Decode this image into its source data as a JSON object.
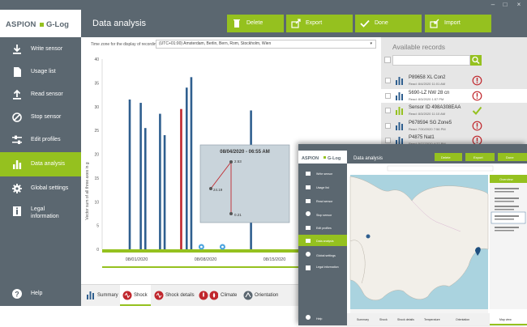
{
  "app": {
    "brand_left": "ASPION",
    "brand_right": "G-Log",
    "title": "Data analysis",
    "window_controls": [
      "–",
      "□",
      "×"
    ]
  },
  "toolbar": {
    "delete": "Delete",
    "export": "Export",
    "done": "Done",
    "import": "Import"
  },
  "sidebar": {
    "items": [
      {
        "label": "Write sensor",
        "icon": "download-icon"
      },
      {
        "label": "Usage list",
        "icon": "document-icon"
      },
      {
        "label": "Read sensor",
        "icon": "upload-icon"
      },
      {
        "label": "Stop sensor",
        "icon": "stop-icon"
      },
      {
        "label": "Edit profiles",
        "icon": "sliders-icon"
      },
      {
        "label": "Data analysis",
        "icon": "bar-chart-icon",
        "active": true
      },
      {
        "label": "Global settings",
        "icon": "gear-icon"
      },
      {
        "label": "Legal information",
        "icon": "info-icon"
      }
    ],
    "help": "Help"
  },
  "timezone": {
    "label": "Time zone for the display of recordings",
    "value": "(UTC+01:00) Amsterdam, Berlin, Bern, Rom, Stockholm, Wien"
  },
  "chart_data": {
    "type": "bar",
    "ylabel": "Vector sum of all three axes in g",
    "ylim": [
      0,
      40
    ],
    "yticks": [
      0,
      5,
      10,
      15,
      20,
      25,
      30,
      35,
      40
    ],
    "xticks": [
      "08/01/2020",
      "08/08/2020",
      "08/15/2020",
      "08/22/2020"
    ],
    "x_domain": [
      0,
      30
    ],
    "bars": [
      {
        "x": 3.0,
        "value": 31.5,
        "color": "#2f5f8f"
      },
      {
        "x": 4.2,
        "value": 30.8,
        "color": "#2f5f8f"
      },
      {
        "x": 4.7,
        "value": 25.5,
        "color": "#2f5f8f"
      },
      {
        "x": 6.3,
        "value": 28.5,
        "color": "#2f5f8f"
      },
      {
        "x": 6.8,
        "value": 24.0,
        "color": "#2f5f8f"
      },
      {
        "x": 8.6,
        "value": 29.5,
        "color": "#c0272d"
      },
      {
        "x": 9.2,
        "value": 34.0,
        "color": "#2f5f8f"
      },
      {
        "x": 9.7,
        "value": 36.2,
        "color": "#2f5f8f"
      },
      {
        "x": 16.2,
        "value": 29.2,
        "color": "#2f5f8f"
      }
    ],
    "markers_x": [
      10.8,
      13.1,
      23.3
    ],
    "tooltip": {
      "title": "08/04/2020 - 06:55 AM",
      "values": [
        "2.53",
        "24.19",
        "0.21"
      ]
    }
  },
  "records": {
    "title": "Available records",
    "items": [
      {
        "name": "P89658 XL Con2",
        "date": "Read: 8/4/2020 11:01 AM",
        "status": "warning"
      },
      {
        "name": "5690-LZ NW 28 cn",
        "date": "Read: 8/3/2020 1:57 PM",
        "status": "warning",
        "selected": true
      },
      {
        "name": "Sensor ID 498A308EAA",
        "date": "Read: 8/3/2020 11:10 AM",
        "status": "ok"
      },
      {
        "name": "P678594 SG Zone5",
        "date": "Read: 7/30/2020 7:56 PM",
        "status": "warning"
      },
      {
        "name": "P4875 Nat1",
        "date": "Read: 5/27/2020 4:27 PM",
        "status": "warning"
      }
    ]
  },
  "tabs": [
    {
      "label": "Summary",
      "icon": "bar-chart-icon"
    },
    {
      "label": "Shock",
      "icon": "shock-icon",
      "active": true
    },
    {
      "label": "Shock details",
      "icon": "shock-details-icon"
    },
    {
      "label": "Climate",
      "icon": "thermometer-icon"
    },
    {
      "label": "Orientation",
      "icon": "orientation-icon"
    }
  ],
  "inset": {
    "title": "Data analysis",
    "buttons": [
      "Delete",
      "Export",
      "Done"
    ],
    "map_header": "Overview",
    "tabs": [
      "Summary",
      "Shock",
      "Shock details",
      "Temperature",
      "Orientation",
      "Map view"
    ],
    "active_tab": "Map view"
  },
  "colors": {
    "accent": "#95c11f",
    "sidebar": "#5b6770",
    "bar": "#2f5f8f",
    "bar_alert": "#c0272d",
    "warning": "#c0272d"
  }
}
